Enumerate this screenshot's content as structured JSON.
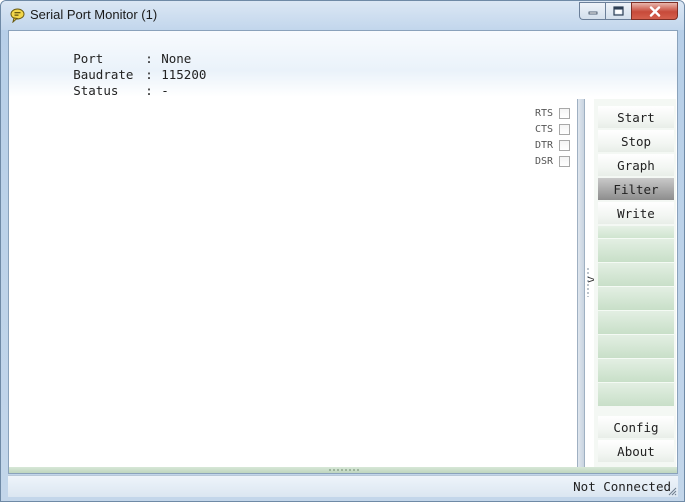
{
  "window": {
    "title": "Serial Port Monitor (1)",
    "icon": "speech-bubble-icon"
  },
  "caption_buttons": {
    "minimize": "minimize-icon",
    "maximize": "maximize-icon",
    "close": "close-icon"
  },
  "info": {
    "rows": [
      {
        "label": "Port",
        "sep": ":",
        "value": "None"
      },
      {
        "label": "Baudrate",
        "sep": ":",
        "value": "115200"
      },
      {
        "label": "Status",
        "sep": ":",
        "value": "-"
      }
    ]
  },
  "control_lines": [
    {
      "label": "RTS",
      "checked": false
    },
    {
      "label": "CTS",
      "checked": false
    },
    {
      "label": "DTR",
      "checked": false
    },
    {
      "label": "DSR",
      "checked": false
    }
  ],
  "splitter": {
    "arrow": ">"
  },
  "buttons": {
    "start": "Start",
    "stop": "Stop",
    "graph": "Graph",
    "filter": "Filter",
    "write": "Write",
    "config": "Config",
    "about": "About"
  },
  "statusbar": {
    "text": "Not Connected"
  },
  "colors": {
    "active_button": "#8d8d8d",
    "panel_green": "#cfe5cf"
  }
}
